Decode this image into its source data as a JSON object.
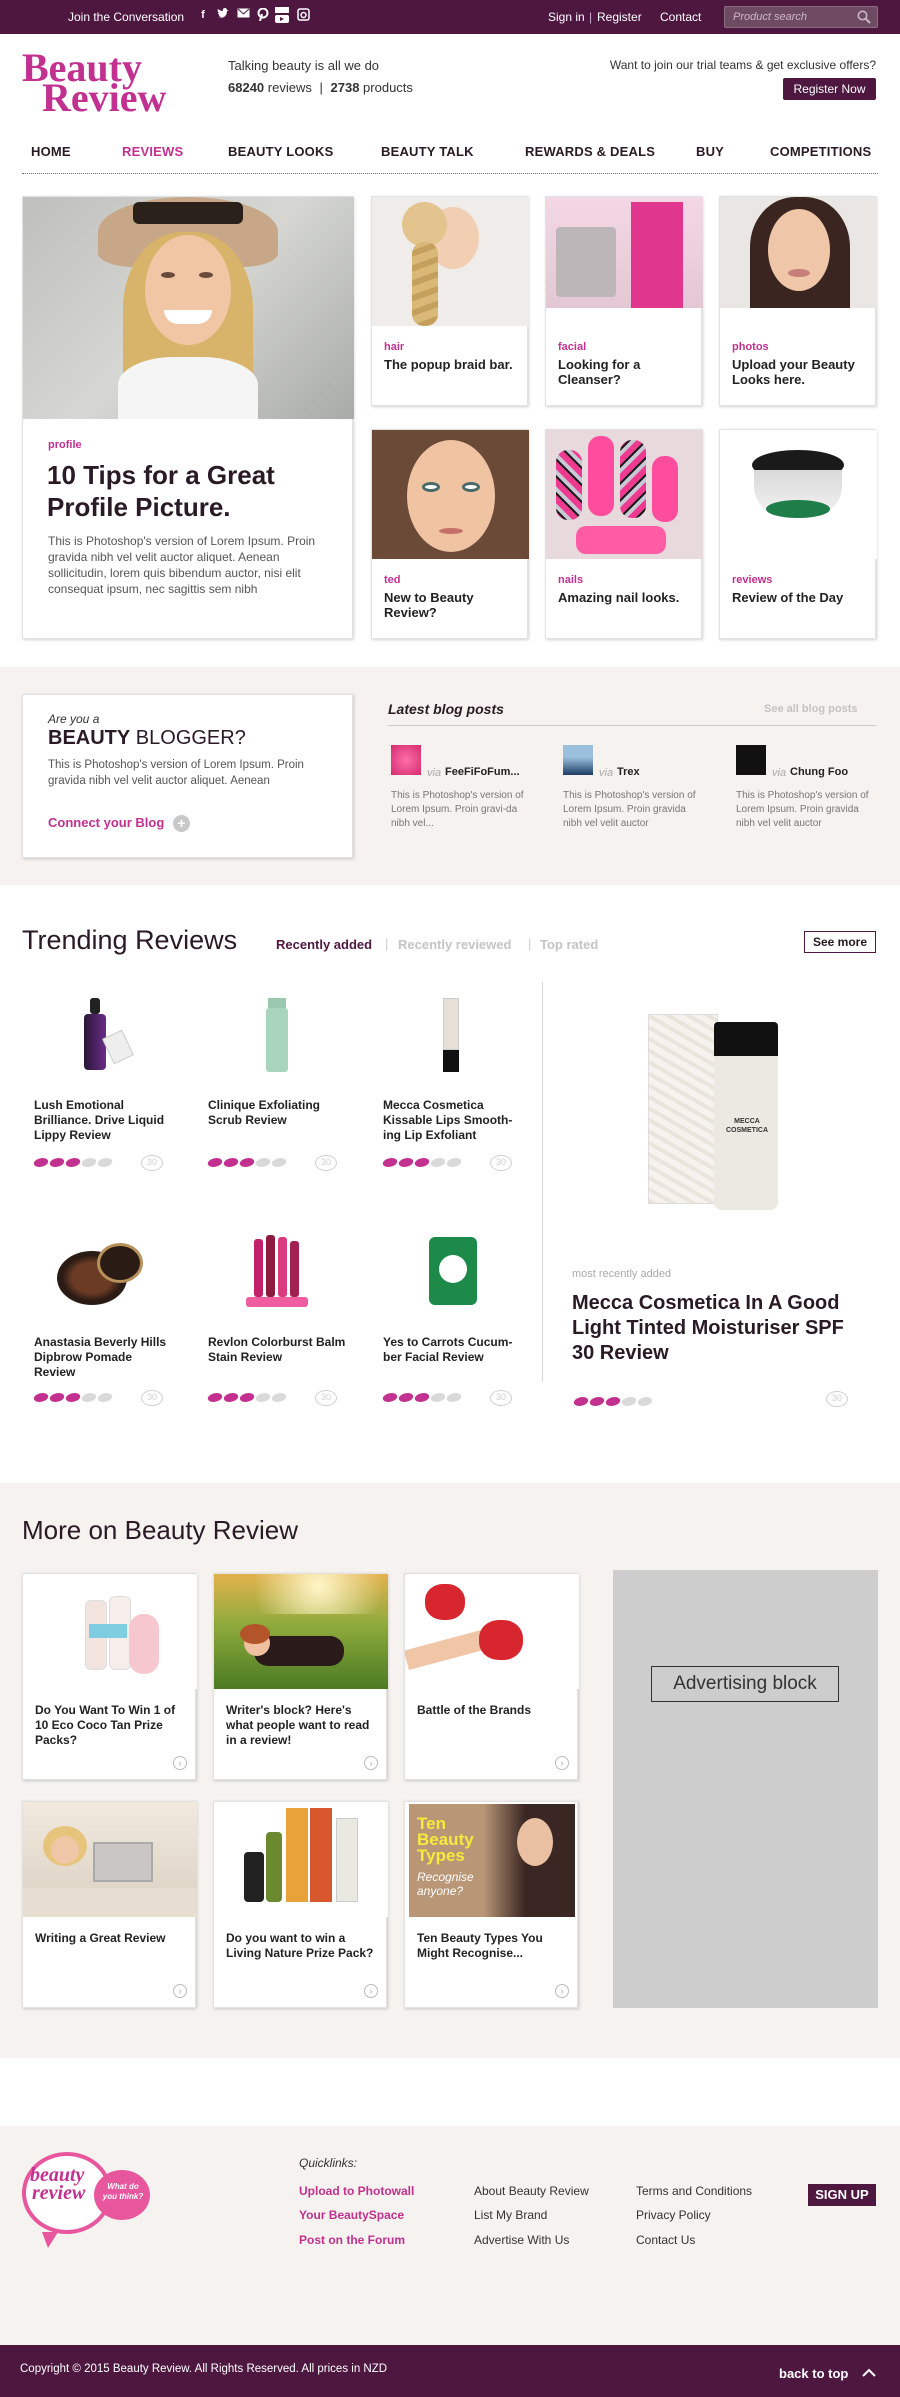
{
  "topbar": {
    "join": "Join the Conversation",
    "social": [
      "facebook-icon",
      "twitter-icon",
      "email-icon",
      "pinterest-icon",
      "youtube-icon",
      "instagram-icon"
    ],
    "sign_in": "Sign in",
    "sep": "|",
    "register": "Register",
    "contact": "Contact",
    "search_placeholder": "Product search"
  },
  "header": {
    "logo_line1": "Beauty",
    "logo_line2": "Review",
    "tagline": "Talking beauty is all we do",
    "reviews_count": "68240",
    "reviews_label": "reviews",
    "pipe": "|",
    "products_count": "2738",
    "products_label": "products",
    "trial_text": "Want to join our trial teams & get exclusive offers?",
    "register_now": "Register Now"
  },
  "nav": [
    "HOME",
    "REVIEWS",
    "BEAUTY LOOKS",
    "BEAUTY TALK",
    "REWARDS & DEALS",
    "BUY",
    "COMPETITIONS"
  ],
  "hero": {
    "tag": "profile",
    "title": "10 Tips for a Great Profile Picture.",
    "body": "This is Photoshop's version  of Lorem Ipsum. Proin gravida nibh vel velit auctor aliquet. Aenean sollicitudin, lorem quis bibendum auctor, nisi elit consequat ipsum, nec sagittis sem nibh"
  },
  "tiles": [
    {
      "tag": "hair",
      "title": "The popup braid bar."
    },
    {
      "tag": "facial",
      "title": "Looking for a Cleanser?"
    },
    {
      "tag": "photos",
      "title": "Upload your Beauty Looks here."
    },
    {
      "tag": "ted",
      "title": "New to Beauty Review?"
    },
    {
      "tag": "nails",
      "title": "Amazing nail looks."
    },
    {
      "tag": "reviews",
      "title": "Review of the Day"
    }
  ],
  "blogger": {
    "are_you": "Are you a",
    "beauty": "BEAUTY",
    "blogger": "BLOGGER?",
    "body": "This is Photoshop's version  of Lorem Ipsum. Proin gravida nibh vel velit auctor aliquet. Aenean",
    "connect": "Connect your Blog"
  },
  "blog": {
    "title": "Latest blog posts",
    "see_all": "See all blog posts",
    "via": "via",
    "posts": [
      {
        "name": "FeeFiFoFum...",
        "body": "This is Photoshop's version of Lorem Ipsum. Proin gravi-da nibh vel..."
      },
      {
        "name": "Trex",
        "body": "This is Photoshop's version of Lorem Ipsum. Proin gravida nibh vel velit auctor"
      },
      {
        "name": "Chung Foo",
        "body": "This is Photoshop's version of Lorem Ipsum. Proin gravida nibh vel velit auctor"
      }
    ]
  },
  "trending": {
    "title": "Trending Reviews",
    "tabs": [
      "Recently added",
      "Recently reviewed",
      "Top rated"
    ],
    "see_more": "See more",
    "products": [
      {
        "name": "Lush Emotional Brilliance. Drive Liquid Lippy Review",
        "rating": 3,
        "comments": "30"
      },
      {
        "name": "Clinique Exfoliating Scrub Review",
        "rating": 3,
        "comments": "30"
      },
      {
        "name": "Mecca Cosmetica Kissable Lips Smooth-ing Lip Exfoliant",
        "rating": 3,
        "comments": "30"
      },
      {
        "name": "Anastasia Beverly Hills Dipbrow Pomade Review",
        "rating": 3,
        "comments": "30"
      },
      {
        "name": "Revlon Colorburst Balm Stain Review",
        "rating": 3,
        "comments": "30"
      },
      {
        "name": "Yes to Carrots Cucum-ber Facial Review",
        "rating": 3,
        "comments": "30"
      }
    ],
    "featured": {
      "label": "most recently added",
      "title": "Mecca Cosmetica In A Good Light Tinted Moisturiser SPF 30 Review",
      "rating": 3,
      "comments": "30",
      "box_text": "MECCA COSMETICA"
    }
  },
  "more": {
    "title": "More on Beauty Review",
    "cards": [
      {
        "title": "Do You Want To Win 1 of 10 Eco Coco Tan Prize Packs?"
      },
      {
        "title": "Writer's block? Here's what people want to read in a review!"
      },
      {
        "title": "Battle of the Brands"
      },
      {
        "title": "Writing a Great Review"
      },
      {
        "title": "Do you want to win a Living Nature Prize Pack?"
      },
      {
        "title": "Ten Beauty Types You Might Recognise..."
      }
    ],
    "ten_types_text": "Ten Beauty Types",
    "recognise_text": "Recognise anyone?",
    "advertising": "Advertising block"
  },
  "footer": {
    "bubble_line1": "beauty",
    "bubble_line2": "review",
    "bubble_small": "What do you think?",
    "quicklinks": "Quicklinks:",
    "col1": [
      "Upload to Photowall",
      "Your BeautySpace",
      "Post on the Forum"
    ],
    "col2": [
      "About Beauty Review",
      "List My Brand",
      "Advertise With Us"
    ],
    "col3": [
      "Terms and Conditions",
      "Privacy Policy",
      "Contact Us"
    ],
    "sign_up": "SIGN UP",
    "copyright": "Copyright © 2015 Beauty Review. All Rights Reserved. All prices in NZD",
    "back_to_top": "back to top"
  },
  "colors": {
    "brand": "#c2318f",
    "dark": "#4d1740",
    "bg_section": "#f5f2ef"
  }
}
